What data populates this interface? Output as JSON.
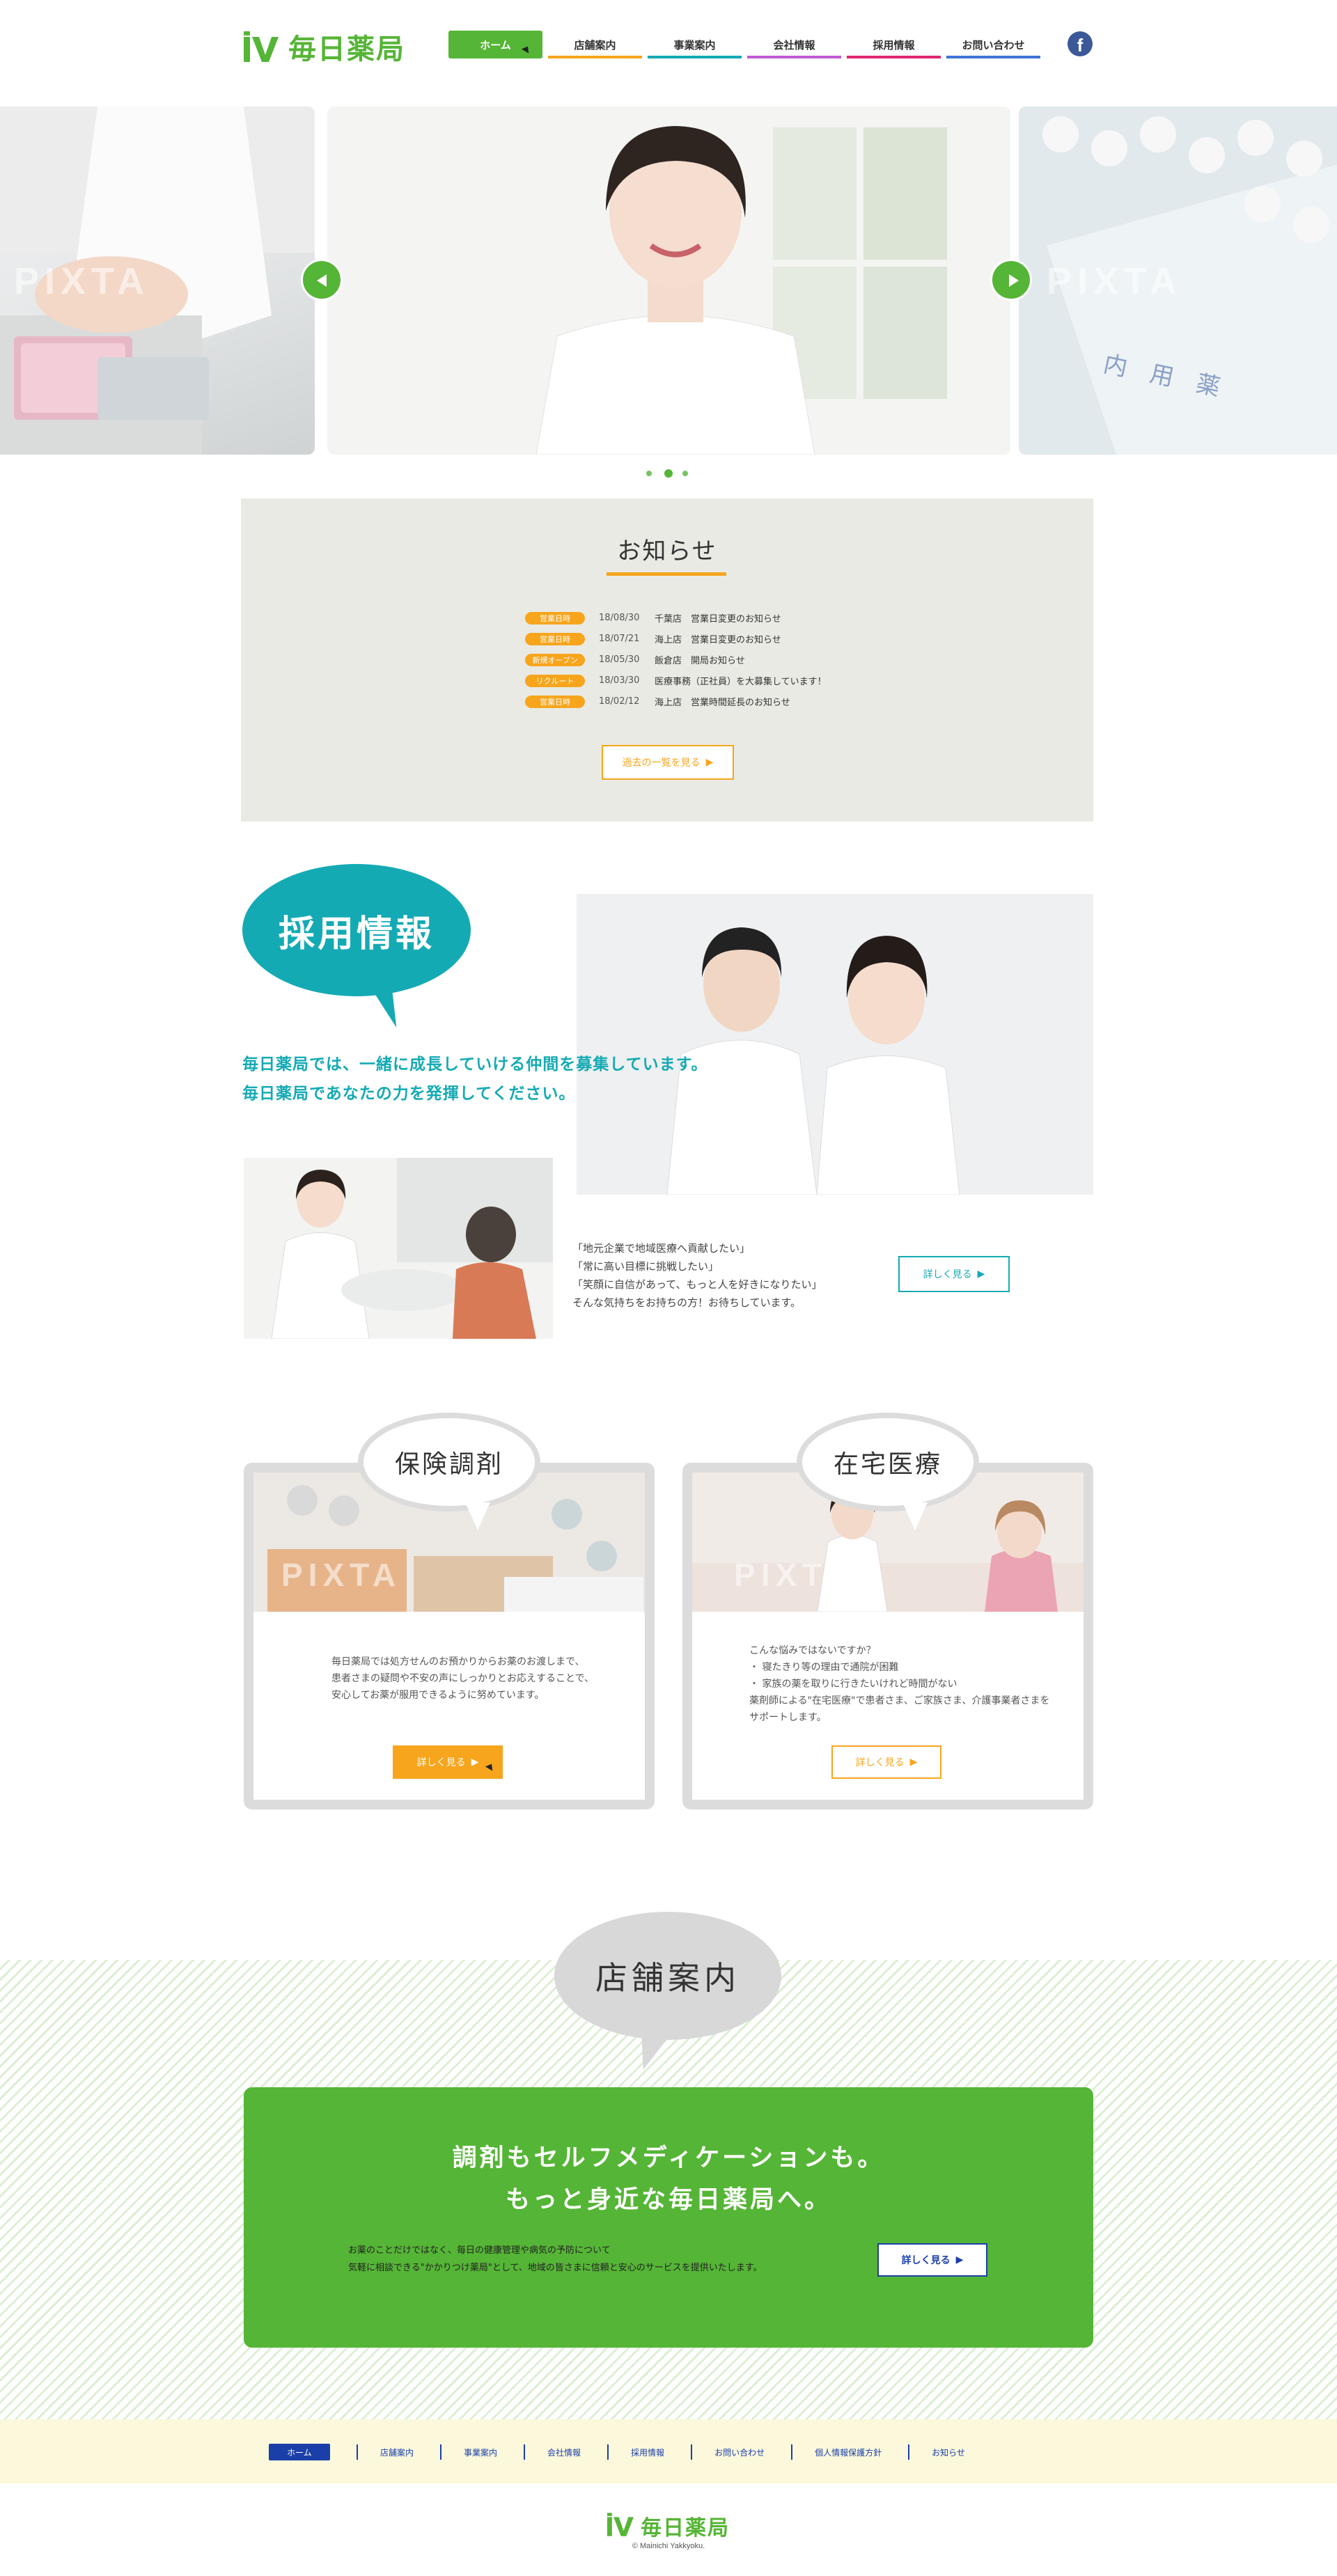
{
  "brand": {
    "name": "毎日薬局",
    "mark": "iV",
    "color": "#55b536"
  },
  "nav": {
    "items": [
      {
        "label": "ホーム",
        "active": true
      },
      {
        "label": "店舗案内",
        "underline": "#f7a51d"
      },
      {
        "label": "事業案内",
        "underline": "#14aab4"
      },
      {
        "label": "会社情報",
        "underline": "#c05ad6"
      },
      {
        "label": "採用情報",
        "underline": "#e0266f"
      },
      {
        "label": "お問い合わせ",
        "underline": "#3d75d6"
      }
    ],
    "facebook_icon": "facebook-icon",
    "facebook_glyph": "f"
  },
  "hero": {
    "watermark": "PIXTA",
    "active_dot": 1,
    "dot_count": 3
  },
  "news": {
    "title": "お知らせ",
    "items": [
      {
        "tag": "営業日時",
        "date": "18/08/30",
        "text": "千葉店　営業日変更のお知らせ"
      },
      {
        "tag": "営業日時",
        "date": "18/07/21",
        "text": "海上店　営業日変更のお知らせ"
      },
      {
        "tag": "新規オープン",
        "date": "18/05/30",
        "text": "飯倉店　開局お知らせ"
      },
      {
        "tag": "リクルート",
        "date": "18/03/30",
        "text": "医療事務（正社員）を大募集しています！"
      },
      {
        "tag": "営業日時",
        "date": "18/02/12",
        "text": "海上店　営業時間延長のお知らせ"
      }
    ],
    "more_label": "過去の一覧を見る"
  },
  "recruit": {
    "title": "採用情報",
    "lead": [
      "毎日薬局では、一緒に成長していける仲間を募集しています。",
      "毎日薬局であなたの力を発揮してください。"
    ],
    "copy": [
      "「地元企業で地域医療へ貢献したい」",
      "「常に高い目標に挑戦したい」",
      "「笑顔に自信があって、もっと人を好きになりたい」",
      "そんな気持ちをお持ちの方！お待ちしています。"
    ],
    "more_label": "詳しく見る"
  },
  "services": [
    {
      "title": "保険調剤",
      "text": [
        "毎日薬局では処方せんのお預かりからお薬のお渡しまで、",
        "患者さまの疑問や不安の声にしっかりとお応えすることで、",
        "安心してお薬が服用できるように努めています。"
      ],
      "more_label": "詳しく見る"
    },
    {
      "title": "在宅医療",
      "text": [
        "こんな悩みではないですか？",
        "・ 寝たきり等の理由で通院が困難",
        "・ 家族の薬を取りに行きたいけれど時間がない",
        "薬剤師による\"在宅医療\"で患者さま、ご家族さま、介護事業者さまを",
        "サポートします。"
      ],
      "more_label": "詳しく見る"
    }
  ],
  "store": {
    "title": "店舗案内",
    "headline": [
      "調剤もセルフメディケーションも。",
      "もっと身近な毎日薬局へ。"
    ],
    "copy": [
      "お薬のことだけではなく、毎日の健康管理や病気の予防について",
      "気軽に相談できる\"かかりつけ薬局\"として、地域の皆さまに信頼と安心のサービスを提供いたします。"
    ],
    "more_label": "詳しく見る"
  },
  "footer": {
    "nav": [
      "ホーム",
      "店舗案内",
      "事業案内",
      "会社情報",
      "採用情報",
      "お問い合わせ",
      "個人情報保護方針",
      "お知らせ"
    ],
    "copyright": "© Mainichi Yakkyoku."
  },
  "colors": {
    "green": "#55b536",
    "orange": "#f7a51d",
    "teal": "#14aab4",
    "navy": "#1b3fa8",
    "gray_bg": "#eaeae4"
  }
}
